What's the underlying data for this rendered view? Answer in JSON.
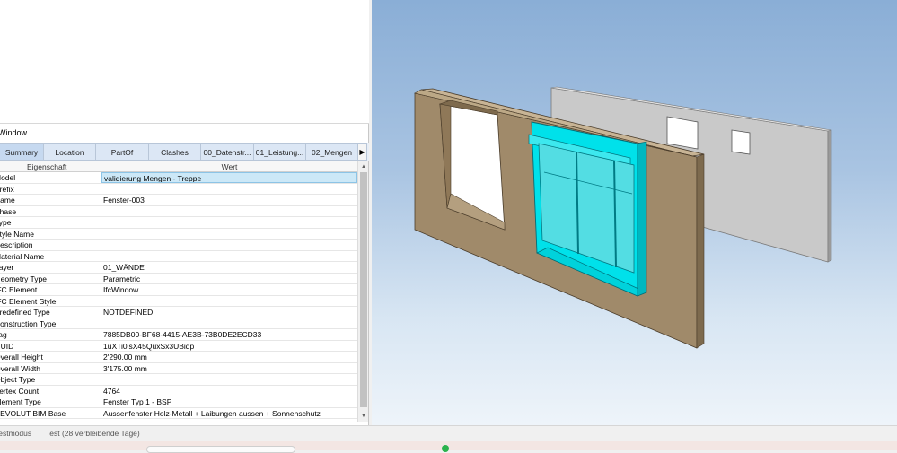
{
  "panel": {
    "title": "Window"
  },
  "tabs": [
    {
      "label": "Summary"
    },
    {
      "label": "Location"
    },
    {
      "label": "PartOf"
    },
    {
      "label": "Clashes"
    },
    {
      "label": "00_Datenstr..."
    },
    {
      "label": "01_Leistung..."
    },
    {
      "label": "02_Mengen"
    }
  ],
  "grid": {
    "col_property": "Eigenschaft",
    "col_value": "Wert",
    "rows": [
      {
        "key": "Model",
        "value": "validierung Mengen - Treppe"
      },
      {
        "key": "Prefix",
        "value": ""
      },
      {
        "key": "Name",
        "value": "Fenster-003"
      },
      {
        "key": "Phase",
        "value": ""
      },
      {
        "key": "Type",
        "value": ""
      },
      {
        "key": "Style Name",
        "value": ""
      },
      {
        "key": "Description",
        "value": ""
      },
      {
        "key": "Material Name",
        "value": ""
      },
      {
        "key": "Layer",
        "value": "01_WÄNDE"
      },
      {
        "key": "Geometry Type",
        "value": "Parametric"
      },
      {
        "key": "IFC Element",
        "value": "IfcWindow"
      },
      {
        "key": "IFC Element Style",
        "value": ""
      },
      {
        "key": "Predefined Type",
        "value": "NOTDEFINED"
      },
      {
        "key": "Construction Type",
        "value": ""
      },
      {
        "key": "Tag",
        "value": "7885DB00-BF68-4415-AE3B-73B0DE2ECD33"
      },
      {
        "key": "GUID",
        "value": "1uXTi0lsX45QuxSx3UBiqp"
      },
      {
        "key": "Overall Height",
        "value": "2'290.00 mm"
      },
      {
        "key": "Overall Width",
        "value": "3'175.00 mm"
      },
      {
        "key": "Object Type",
        "value": ""
      },
      {
        "key": "Vertex Count",
        "value": "4764"
      },
      {
        "key": "Element Type",
        "value": "Fenster Typ 1 - BSP"
      },
      {
        "key": "REVOLUT BIM Base",
        "value": "Aussenfenster Holz-Metall + Laibungen aussen + Sonnenschutz"
      }
    ]
  },
  "status": {
    "mode": "Testmodus",
    "test": "Test (28 verbleibende Tage)"
  },
  "colors": {
    "selection": "#00e5ee",
    "wall": "#a0896a",
    "back_wall": "#c8c8c8",
    "viewport_top": "#8aaed6"
  }
}
